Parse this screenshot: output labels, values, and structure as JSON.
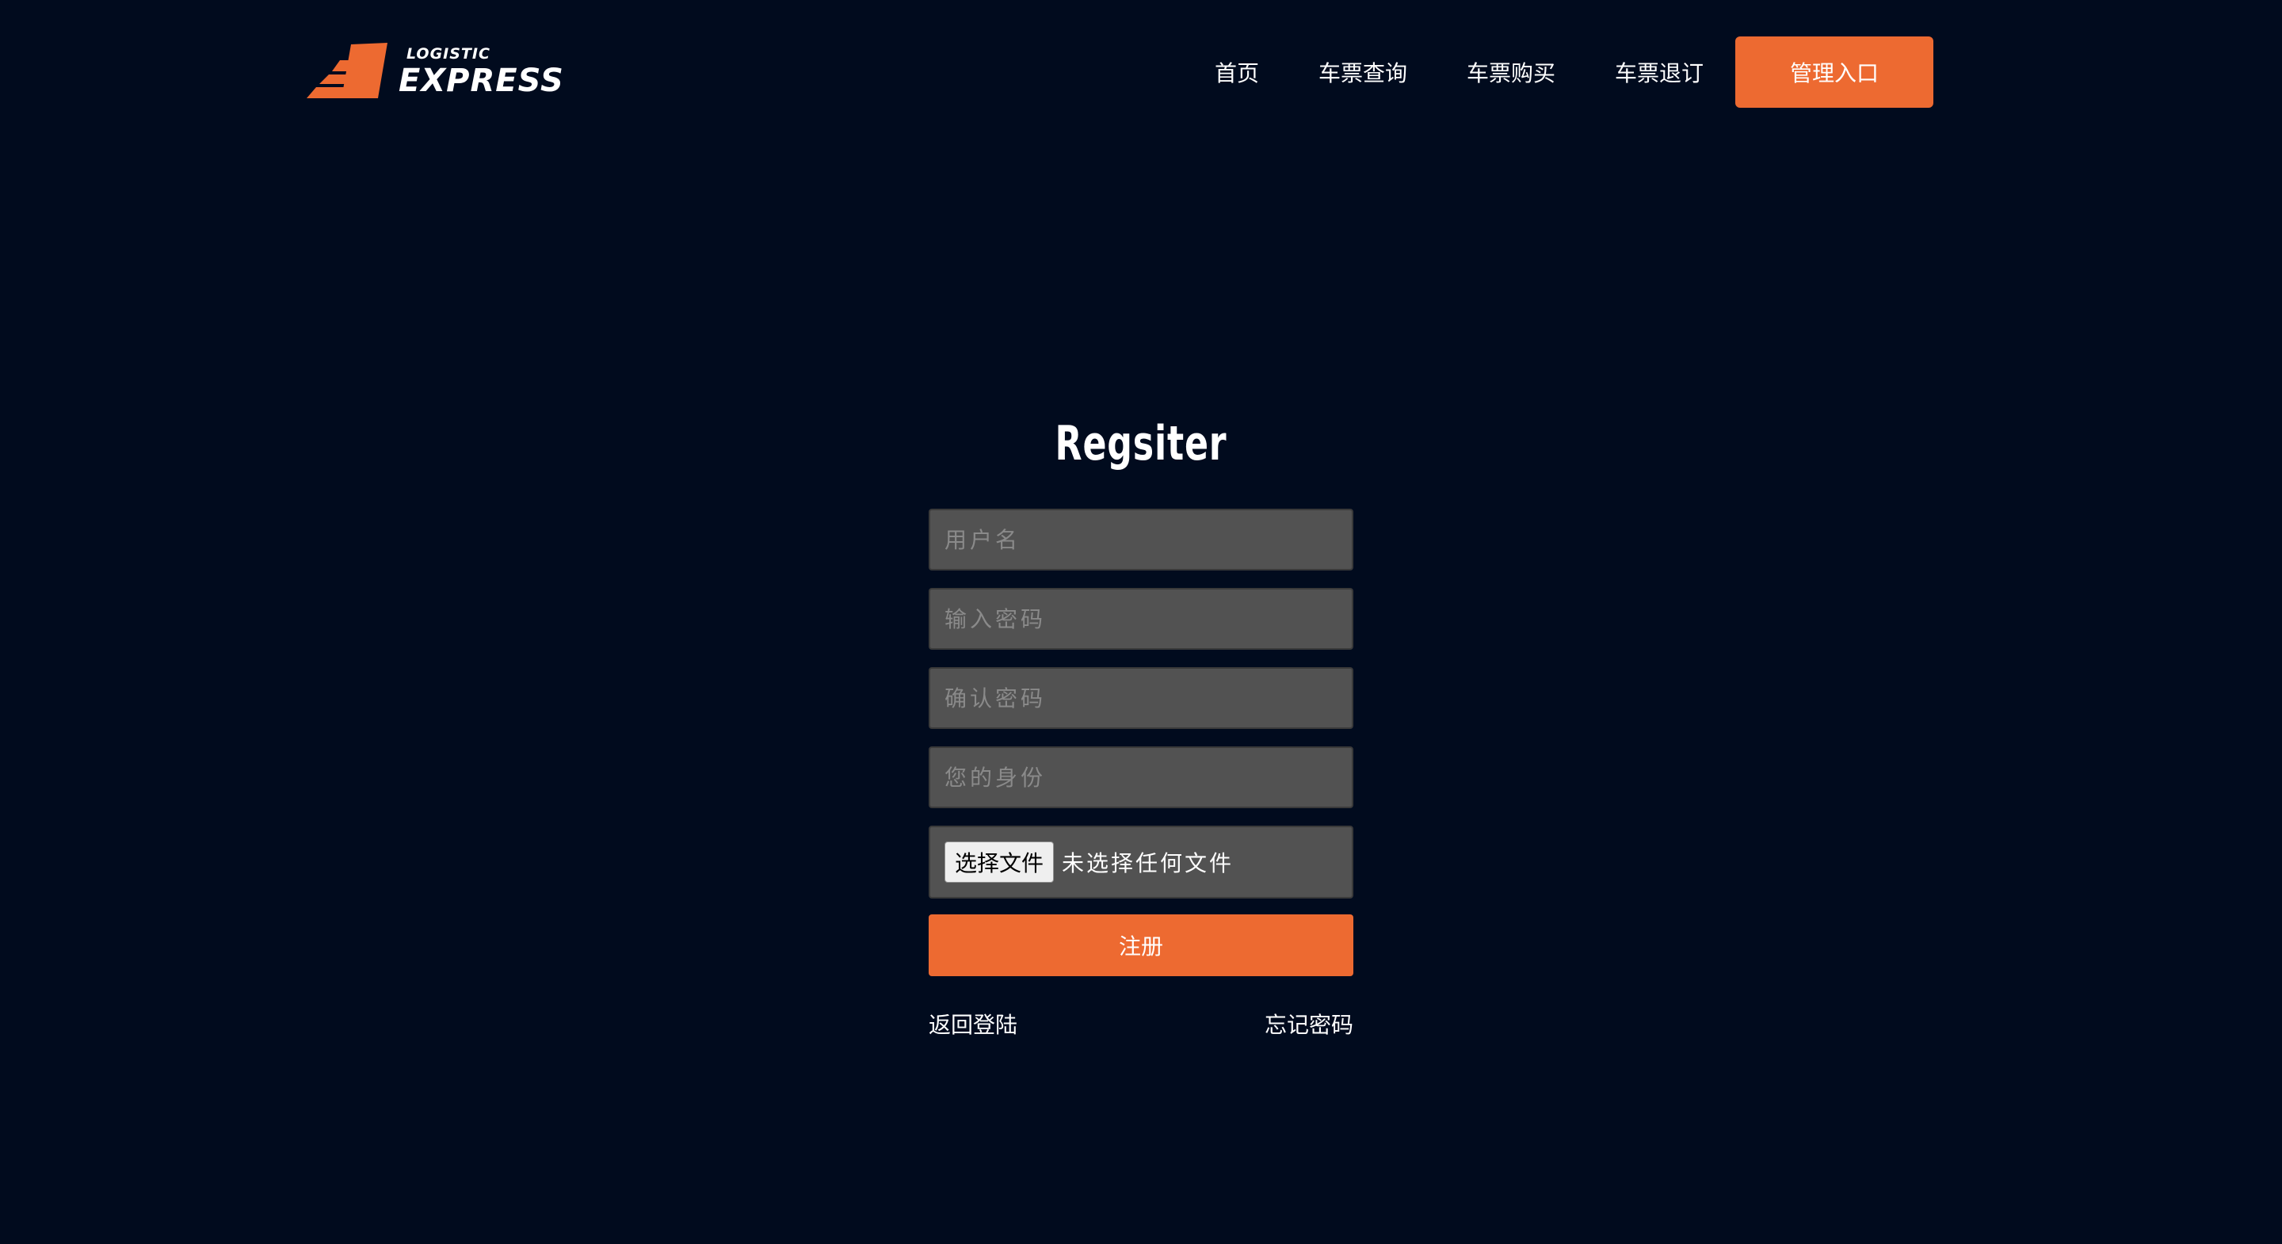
{
  "brand": {
    "logo_small": "LOGISTIC",
    "logo_big": "EXPRESS",
    "accent_color": "#ed6a31",
    "background_color": "#010b1e"
  },
  "nav": {
    "home": "首页",
    "ticket_query": "车票查询",
    "ticket_purchase": "车票购买",
    "ticket_refund": "车票退订",
    "admin_entry": "管理入口"
  },
  "register": {
    "title": "Regsiter",
    "username_placeholder": "用户名",
    "password_placeholder": "输入密码",
    "confirm_password_placeholder": "确认密码",
    "identity_placeholder": "您的身份",
    "file_button_label": "选择文件",
    "file_status": "未选择任何文件",
    "submit_label": "注册",
    "back_to_login": "返回登陆",
    "forgot_password": "忘记密码"
  },
  "icons": {
    "logo": "speed-arrow-logo-icon"
  }
}
